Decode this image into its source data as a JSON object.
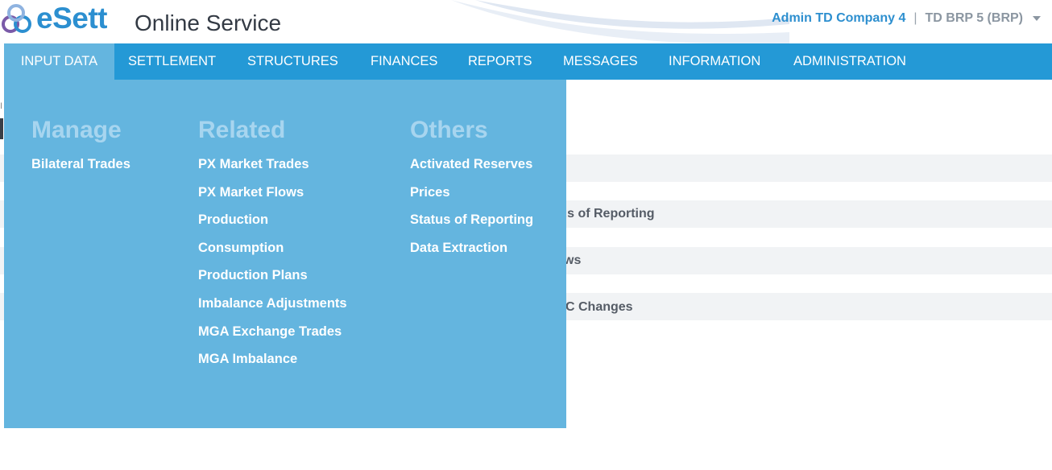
{
  "header": {
    "brand": "eSett",
    "service": "Online Service",
    "company": "Admin TD Company 4",
    "separator": "|",
    "role": "TD BRP 5 (BRP)"
  },
  "nav": {
    "items": [
      {
        "label": "INPUT DATA",
        "active": true
      },
      {
        "label": "SETTLEMENT"
      },
      {
        "label": "STRUCTURES"
      },
      {
        "label": "FINANCES"
      },
      {
        "label": "REPORTS"
      },
      {
        "label": "MESSAGES"
      },
      {
        "label": "INFORMATION"
      },
      {
        "label": "ADMINISTRATION"
      }
    ]
  },
  "dropdown": {
    "columns": [
      {
        "heading": "Manage",
        "items": [
          "Bilateral Trades"
        ]
      },
      {
        "heading": "Related",
        "items": [
          "PX Market Trades",
          "PX Market Flows",
          "Production",
          "Consumption",
          "Production Plans",
          "Imbalance Adjustments",
          "MGA Exchange Trades",
          "MGA Imbalance"
        ]
      },
      {
        "heading": "Others",
        "items": [
          "Activated Reserves",
          "Prices",
          "Status of Reporting",
          "Data Extraction"
        ]
      }
    ]
  },
  "background": {
    "breadcrumb_fragment": "I",
    "rows": [
      "",
      "tus of Reporting",
      "ws",
      "C Changes"
    ]
  },
  "colors": {
    "brand": "#2c8fd0",
    "nav_bg": "#2499d6",
    "dropdown_bg": "#64b5df",
    "heading": "#a7d5ef"
  },
  "icons": {
    "logo": "esett-logo-icon",
    "user_menu": "chevron-down-icon"
  }
}
